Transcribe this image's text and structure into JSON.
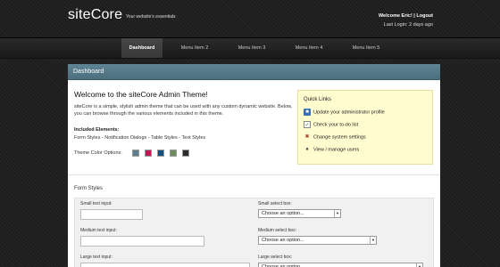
{
  "header": {
    "logo": "siteCore",
    "tagline": "Your website's essentials",
    "welcome": "Welcome Eric! | Logout",
    "last_login": "Last Login: 2 days ago"
  },
  "nav": {
    "items": [
      {
        "label": "Dashboard"
      },
      {
        "label": "Menu Item 2"
      },
      {
        "label": "Menu Item 3"
      },
      {
        "label": "Menu Item 4"
      },
      {
        "label": "Menu Item 5"
      }
    ]
  },
  "panel": {
    "title": "Dashboard"
  },
  "welcome": {
    "title": "Welcome to the siteCore Admin Theme!",
    "intro": "siteCore is a simple, stylish admin theme that can be used with any custom dynamic website. Below, you can browse through the various elements included in this theme.",
    "included_title": "Included Elements:",
    "included_links": "Form Styles - Notification Dialogs - Table Styles - Text Styles",
    "color_label": "Theme Color Options:",
    "colors": [
      "#5d7d8c",
      "#cc1155",
      "#1a4e7a",
      "#6e8c5c",
      "#2b2b2b"
    ]
  },
  "quicklinks": {
    "title": "Quick Links",
    "items": [
      {
        "label": "Update your administrator profile",
        "icon": "profile-icon"
      },
      {
        "label": "Check your to-do list",
        "icon": "checklist-icon"
      },
      {
        "label": "Change system settings",
        "icon": "settings-icon"
      },
      {
        "label": "View / manage users",
        "icon": "users-icon"
      }
    ]
  },
  "forms": {
    "title": "Form Styles",
    "small_text_label": "Small text input:",
    "medium_text_label": "Medium text input:",
    "large_text_label": "Large text input:",
    "small_select_label": "Small select box:",
    "medium_select_label": "Medium select box:",
    "large_select_label": "Large select box:",
    "select_placeholder": "Choose an option..."
  }
}
